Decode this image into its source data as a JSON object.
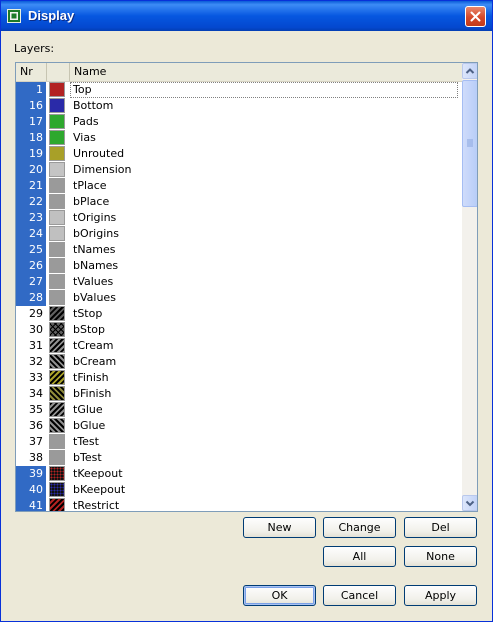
{
  "window": {
    "title": "Display"
  },
  "layers_label": "Layers:",
  "columns": {
    "nr": "Nr",
    "name": "Name"
  },
  "layers": [
    {
      "nr": "1",
      "name": "Top",
      "color": "#b22222",
      "pattern": "solid",
      "selected": true,
      "focus": true
    },
    {
      "nr": "16",
      "name": "Bottom",
      "color": "#2a2aa8",
      "pattern": "solid",
      "selected": true
    },
    {
      "nr": "17",
      "name": "Pads",
      "color": "#2ea82e",
      "pattern": "solid",
      "selected": true
    },
    {
      "nr": "18",
      "name": "Vias",
      "color": "#2ea82e",
      "pattern": "solid",
      "selected": true
    },
    {
      "nr": "19",
      "name": "Unrouted",
      "color": "#a8a028",
      "pattern": "solid",
      "selected": true
    },
    {
      "nr": "20",
      "name": "Dimension",
      "color": "#c4c4c4",
      "pattern": "solid",
      "selected": true
    },
    {
      "nr": "21",
      "name": "tPlace",
      "color": "#9a9a9a",
      "pattern": "solid",
      "selected": true
    },
    {
      "nr": "22",
      "name": "bPlace",
      "color": "#9a9a9a",
      "pattern": "solid",
      "selected": true
    },
    {
      "nr": "23",
      "name": "tOrigins",
      "color": "#c0c0c0",
      "pattern": "solid",
      "selected": true
    },
    {
      "nr": "24",
      "name": "bOrigins",
      "color": "#c0c0c0",
      "pattern": "solid",
      "selected": true
    },
    {
      "nr": "25",
      "name": "tNames",
      "color": "#9a9a9a",
      "pattern": "solid",
      "selected": true
    },
    {
      "nr": "26",
      "name": "bNames",
      "color": "#9a9a9a",
      "pattern": "solid",
      "selected": true
    },
    {
      "nr": "27",
      "name": "tValues",
      "color": "#9a9a9a",
      "pattern": "solid",
      "selected": true
    },
    {
      "nr": "28",
      "name": "bValues",
      "color": "#9a9a9a",
      "pattern": "solid",
      "selected": true
    },
    {
      "nr": "29",
      "name": "tStop",
      "color": "#606060",
      "pattern": "hatch",
      "selected": false
    },
    {
      "nr": "30",
      "name": "bStop",
      "color": "#606060",
      "pattern": "crosshatch",
      "selected": false
    },
    {
      "nr": "31",
      "name": "tCream",
      "color": "#909090",
      "pattern": "hatch",
      "selected": false
    },
    {
      "nr": "32",
      "name": "bCream",
      "color": "#909090",
      "pattern": "hatch-rev",
      "selected": false
    },
    {
      "nr": "33",
      "name": "tFinish",
      "color": "#a8a028",
      "pattern": "hatch",
      "selected": false
    },
    {
      "nr": "34",
      "name": "bFinish",
      "color": "#8e8a3a",
      "pattern": "hatch-rev",
      "selected": false
    },
    {
      "nr": "35",
      "name": "tGlue",
      "color": "#909090",
      "pattern": "hatch",
      "selected": false
    },
    {
      "nr": "36",
      "name": "bGlue",
      "color": "#909090",
      "pattern": "hatch-rev",
      "selected": false
    },
    {
      "nr": "37",
      "name": "tTest",
      "color": "#9a9a9a",
      "pattern": "solid",
      "selected": false
    },
    {
      "nr": "38",
      "name": "bTest",
      "color": "#9a9a9a",
      "pattern": "solid",
      "selected": false
    },
    {
      "nr": "39",
      "name": "tKeepout",
      "color": "#b22222",
      "pattern": "dots",
      "selected": true
    },
    {
      "nr": "40",
      "name": "bKeepout",
      "color": "#2a2aa8",
      "pattern": "dots",
      "selected": true
    },
    {
      "nr": "41",
      "name": "tRestrict",
      "color": "#b22222",
      "pattern": "hatch",
      "selected": true
    }
  ],
  "buttons": {
    "new": "New",
    "change": "Change",
    "del": "Del",
    "all": "All",
    "none": "None",
    "ok": "OK",
    "cancel": "Cancel",
    "apply": "Apply"
  },
  "colors": {
    "selection": "#316ac5",
    "dialog_bg": "#ece9d8",
    "titlebar": "#0657e0",
    "close": "#d5472a"
  },
  "icons": {
    "title": "eagle-app-icon",
    "close": "close-icon",
    "scroll_up": "chevron-up-icon",
    "scroll_down": "chevron-down-icon",
    "grip": "scroll-grip-icon"
  }
}
